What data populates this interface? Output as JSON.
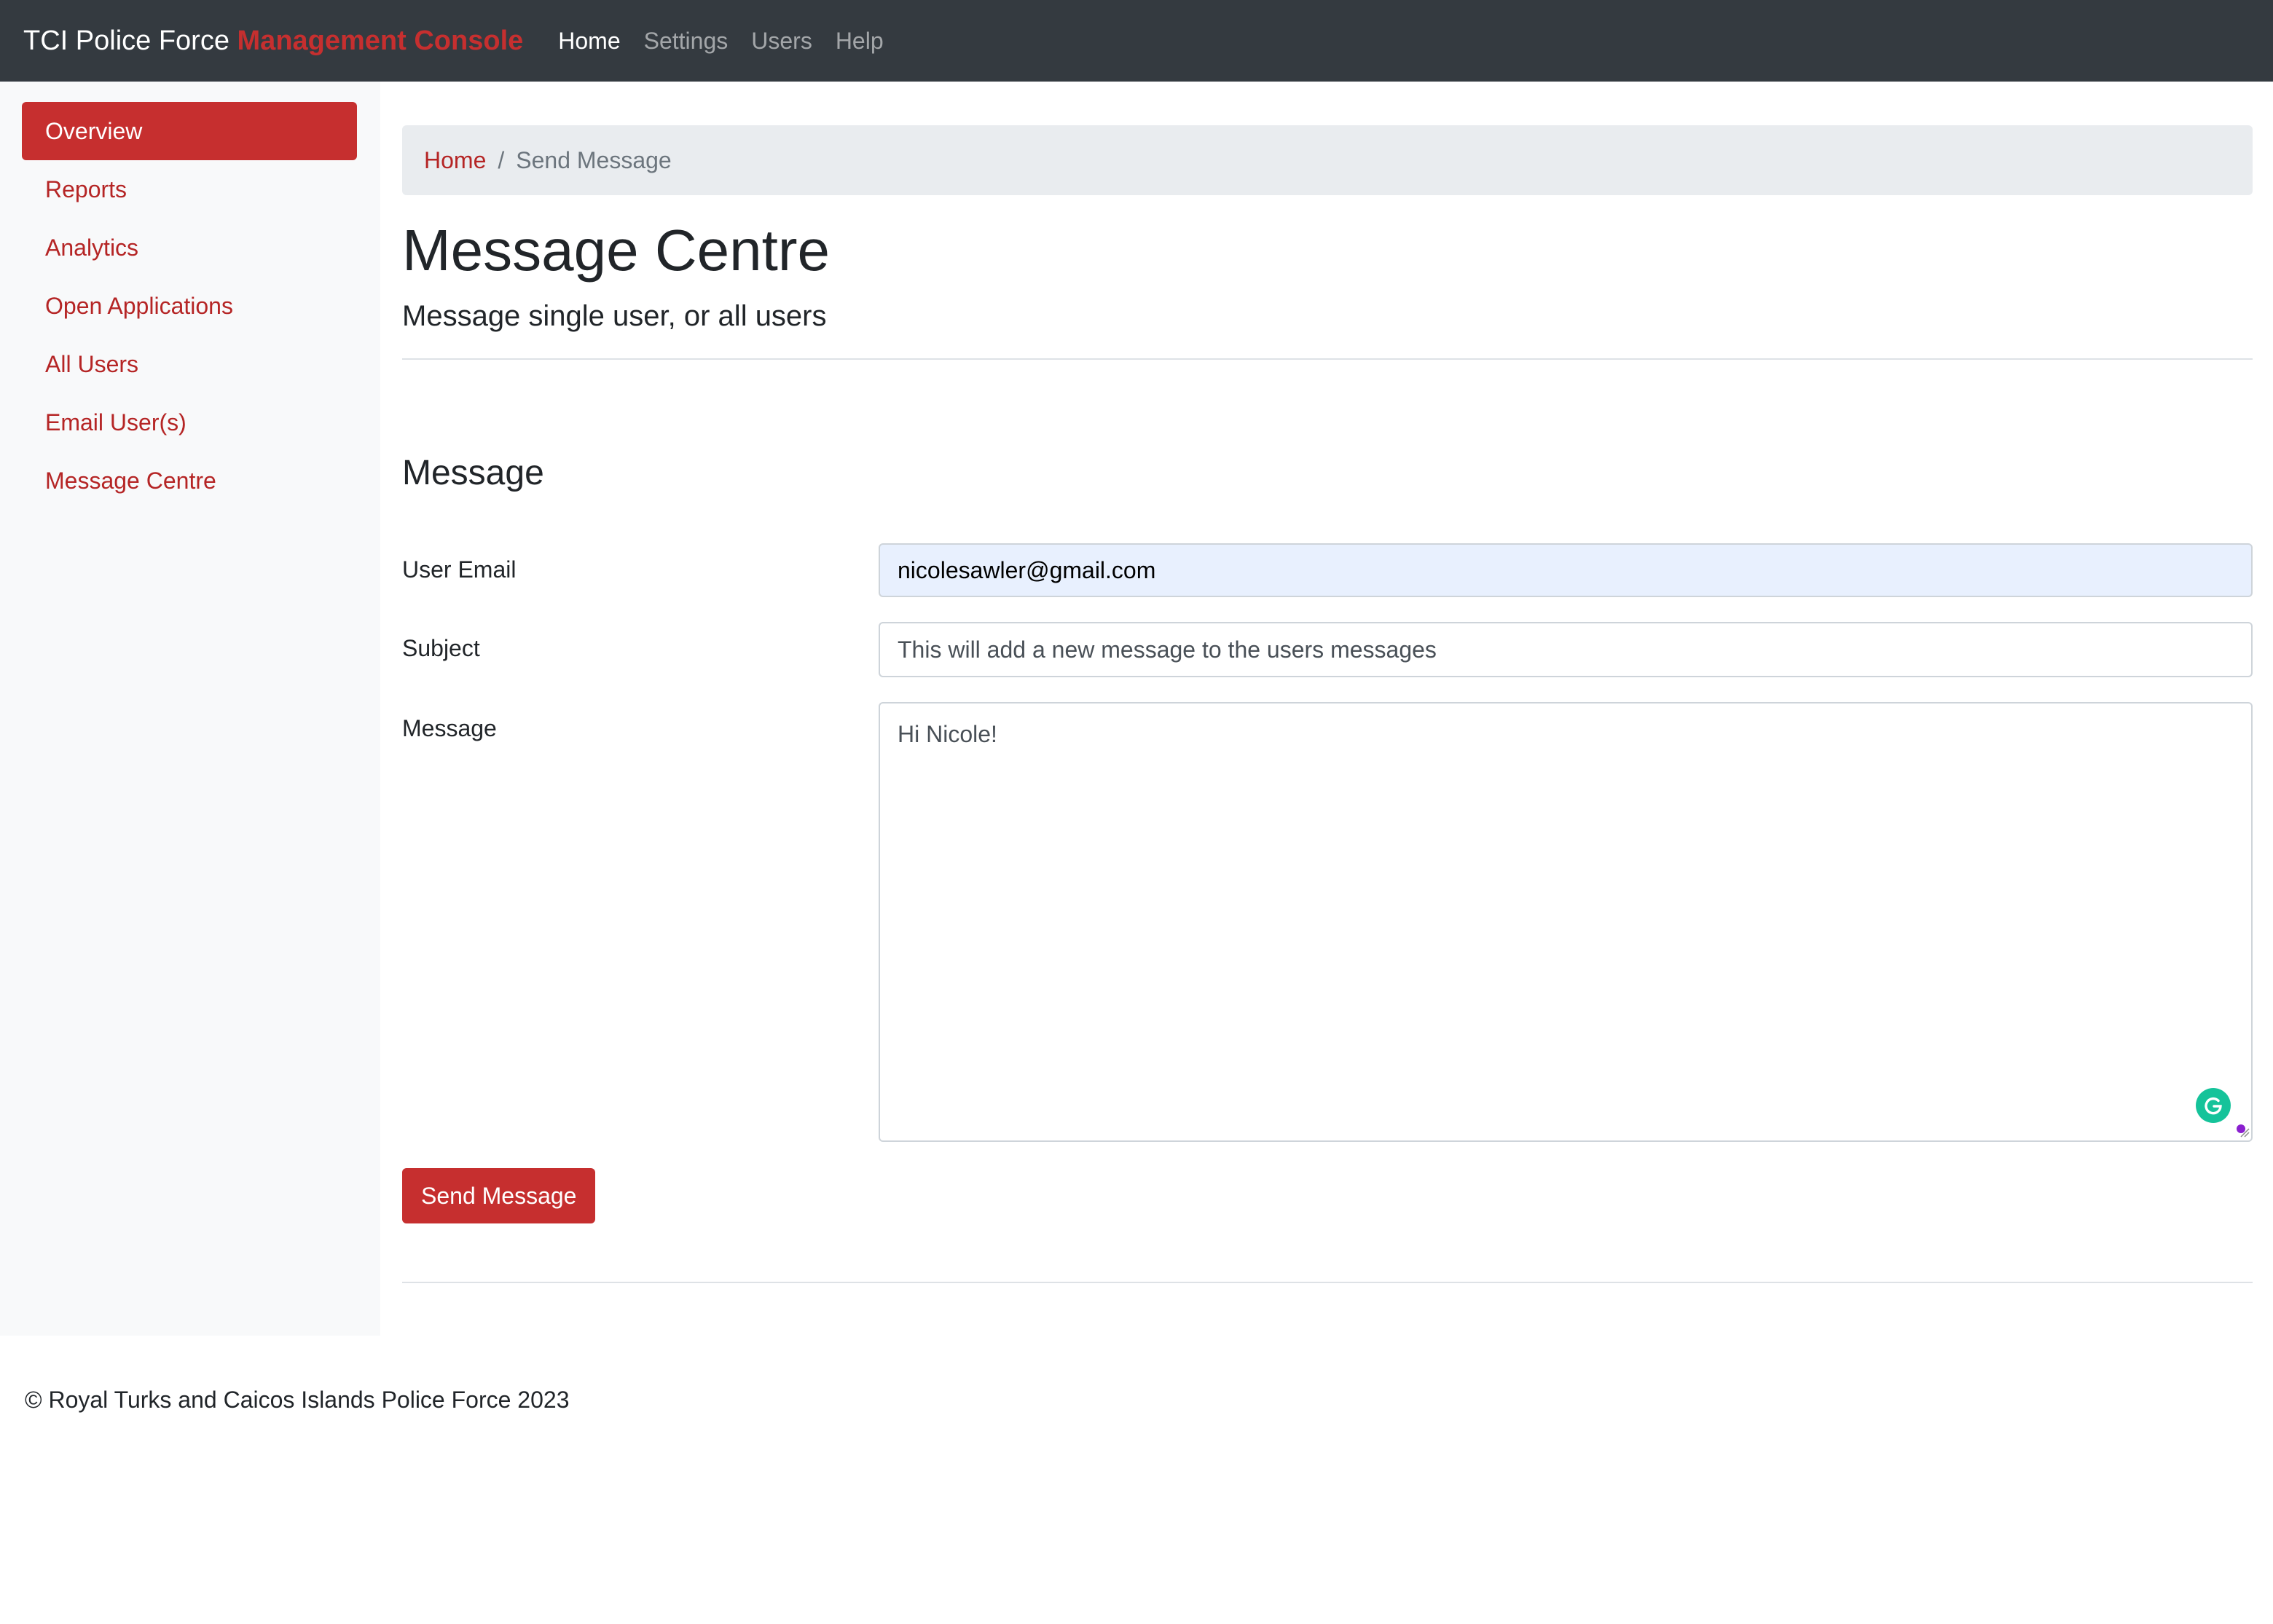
{
  "navbar": {
    "brand_prefix": "TCI Police Force",
    "brand_accent": "Management Console",
    "links": [
      {
        "label": "Home",
        "active": true
      },
      {
        "label": "Settings",
        "active": false
      },
      {
        "label": "Users",
        "active": false
      },
      {
        "label": "Help",
        "active": false
      }
    ]
  },
  "sidebar": {
    "items": [
      {
        "label": "Overview",
        "active": true
      },
      {
        "label": "Reports",
        "active": false
      },
      {
        "label": "Analytics",
        "active": false
      },
      {
        "label": "Open Applications",
        "active": false
      },
      {
        "label": "All Users",
        "active": false
      },
      {
        "label": "Email User(s)",
        "active": false
      },
      {
        "label": "Message Centre",
        "active": false
      }
    ]
  },
  "breadcrumb": {
    "home": "Home",
    "separator": "/",
    "current": "Send Message"
  },
  "page": {
    "title": "Message Centre",
    "subtitle": "Message single user, or all users"
  },
  "form": {
    "section_title": "Message",
    "email_label": "User Email",
    "email_value": "nicolesawler@gmail.com",
    "subject_label": "Subject",
    "subject_value": "This will add a new message to the users messages",
    "message_label": "Message",
    "message_value": "Hi Nicole!",
    "submit_label": "Send Message"
  },
  "grammarly_icon": "grammarly-g-icon",
  "footer": {
    "text": "© Royal Turks and Caicos Islands Police Force 2023"
  },
  "colors": {
    "navbar_bg": "#343a40",
    "accent_red": "#c62f2f",
    "link_red": "#b52525",
    "sidebar_bg": "#f8f9fa",
    "breadcrumb_bg": "#e9ecef",
    "autofill_bg": "#e8f0fe",
    "grammarly_green": "#15c39a"
  }
}
